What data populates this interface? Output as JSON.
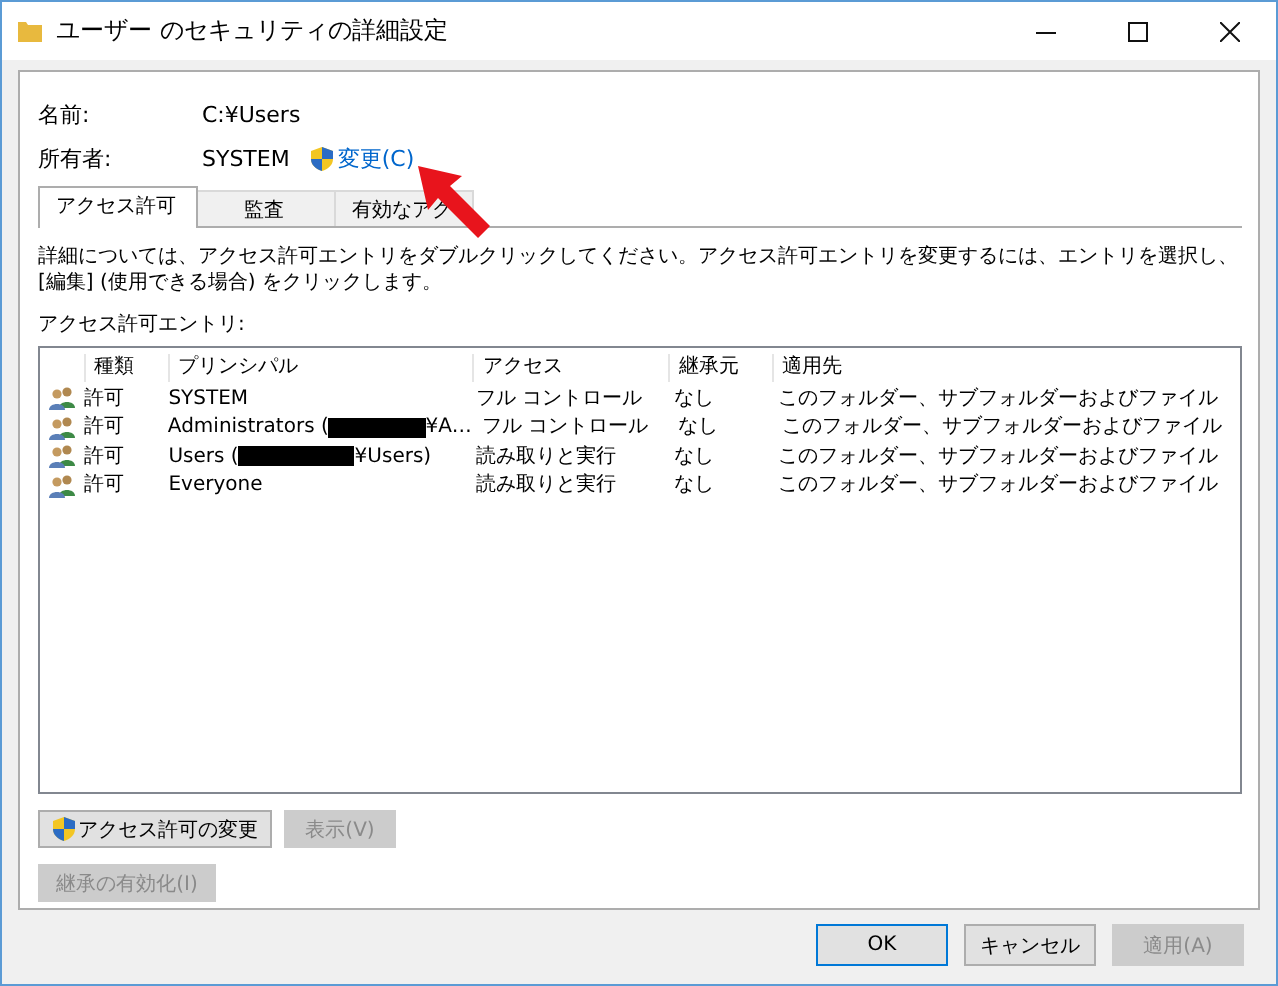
{
  "window": {
    "title": "ユーザー のセキュリティの詳細設定"
  },
  "info": {
    "name_label": "名前:",
    "name_value": "C:¥Users",
    "owner_label": "所有者:",
    "owner_value": "SYSTEM",
    "change_link": "変更(C)"
  },
  "tabs": [
    {
      "label": "アクセス許可",
      "selected": true
    },
    {
      "label": "監査",
      "selected": false
    },
    {
      "label": "有効なアク",
      "selected": false
    }
  ],
  "description": "詳細については、アクセス許可エントリをダブルクリックしてください。アクセス許可エントリを変更するには、エントリを選択し、[編集] (使用できる場合) をクリックします。",
  "entries_label": "アクセス許可エントリ:",
  "table": {
    "columns": [
      "種類",
      "プリンシパル",
      "アクセス",
      "継承元",
      "適用先"
    ],
    "rows": [
      {
        "type": "許可",
        "principal": "SYSTEM",
        "access": "フル コントロール",
        "inherited": "なし",
        "applies": "このフォルダー、サブフォルダーおよびファイル"
      },
      {
        "type": "許可",
        "principal": "Administrators (",
        "redacted": true,
        "principal_end": "¥A…",
        "access": "フル コントロール",
        "inherited": "なし",
        "applies": "このフォルダー、サブフォルダーおよびファイル"
      },
      {
        "type": "許可",
        "principal": "Users (",
        "redacted": true,
        "principal_end": "¥Users)",
        "access": "読み取りと実行",
        "inherited": "なし",
        "applies": "このフォルダー、サブフォルダーおよびファイル"
      },
      {
        "type": "許可",
        "principal": "Everyone",
        "access": "読み取りと実行",
        "inherited": "なし",
        "applies": "このフォルダー、サブフォルダーおよびファイル"
      }
    ]
  },
  "actions": [
    {
      "label": "アクセス許可の変更",
      "shield": true,
      "disabled": false
    },
    {
      "label": "表示(V)",
      "disabled": true
    }
  ],
  "inherit_button": {
    "label": "継承の有効化(I)",
    "disabled": true
  },
  "footer_buttons": [
    {
      "label": "OK",
      "default": true,
      "disabled": false
    },
    {
      "label": "キャンセル",
      "default": false,
      "disabled": false
    },
    {
      "label": "適用(A)",
      "default": false,
      "disabled": true
    }
  ]
}
